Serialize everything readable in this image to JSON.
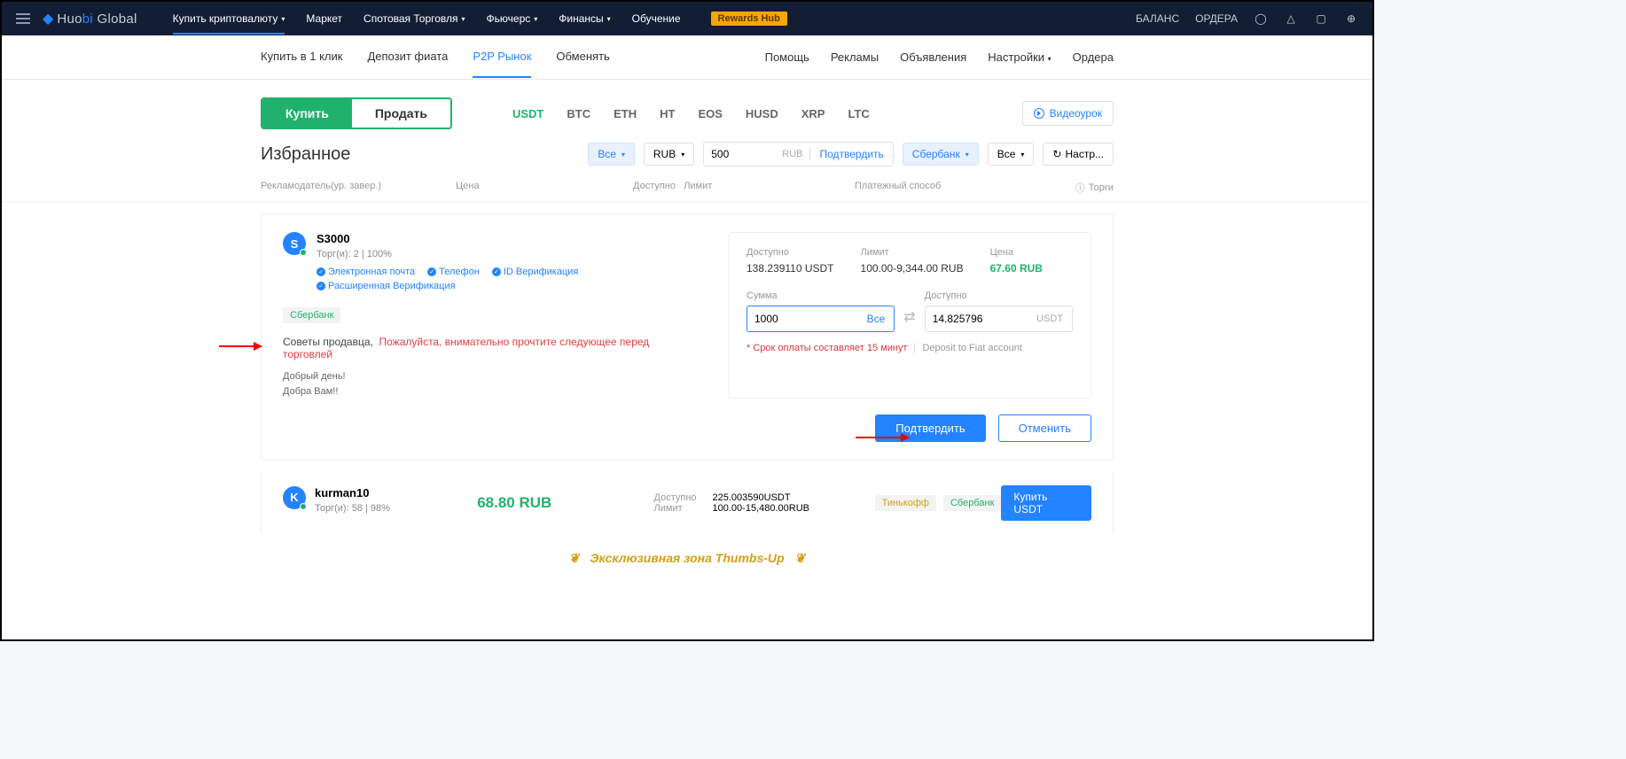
{
  "topnav": {
    "logo_prefix": "Huo",
    "logo_mid": "bi",
    "logo_suffix": " Global",
    "items": [
      "Купить криптовалюту",
      "Маркет",
      "Спотовая Торговля",
      "Фьючерс",
      "Финансы",
      "Обучение"
    ],
    "rewards": "Rewards Hub",
    "right": [
      "БАЛАНС",
      "ОРДЕРА"
    ]
  },
  "subnav": {
    "left": [
      "Купить в 1 клик",
      "Депозит фиата",
      "P2P Рынок",
      "Обменять"
    ],
    "right": [
      "Помощь",
      "Рекламы",
      "Объявления",
      "Настройки",
      "Ордера"
    ]
  },
  "buysell": {
    "buy": "Купить",
    "sell": "Продать"
  },
  "coins": [
    "USDT",
    "BTC",
    "ETH",
    "HT",
    "EOS",
    "HUSD",
    "XRP",
    "LTC"
  ],
  "video_link": "Видеоурок",
  "filters": {
    "title": "Избранное",
    "all": "Все",
    "fiat": "RUB",
    "amount": "500",
    "amount_cur": "RUB",
    "confirm": "Подтвердить",
    "bank": "Сбербанк",
    "all2": "Все",
    "settings": "Настр..."
  },
  "table_head": {
    "adv": "Рекламодатель(ур. завер.)",
    "price": "Цена",
    "avail": "Доступно",
    "limit": "Лимит",
    "pay": "Платежный способ",
    "trades": "Торги"
  },
  "card": {
    "avatar": "S",
    "name": "S3000",
    "stats": "Торг(и): 2 | 100%",
    "badges": [
      "Электронная почта",
      "Телефон",
      "ID Верификация",
      "Расширенная Верификация"
    ],
    "pay_method": "Сбербанк",
    "advice_lbl": "Советы продавца,",
    "advice_warn": "Пожалуйста, внимательно прочтите следующее перед торговлей",
    "greet1": "Добрый день!",
    "greet2": "Добра Вам!!",
    "box": {
      "avail_lbl": "Доступно",
      "avail_val": "138.239110 USDT",
      "limit_lbl": "Лимит",
      "limit_val": "100.00-9,344.00 RUB",
      "price_lbl": "Цена",
      "price_val": "67.60 RUB",
      "sum_lbl": "Сумма",
      "sum_val": "1000",
      "all": "Все",
      "recv_lbl": "Доступно",
      "recv_val": "14.825796",
      "recv_unit": "USDT",
      "deadline": "* Срок оплаты составляет 15 минут",
      "deposit": "Deposit to Fiat account"
    },
    "confirm": "Подтвердить",
    "cancel": "Отменить"
  },
  "listing2": {
    "avatar": "K",
    "name": "kurman10",
    "stats": "Торг(и): 58 | 98%",
    "price": "68.80 RUB",
    "avail_lbl": "Доступно",
    "avail_val": "225.003590USDT",
    "limit_lbl": "Лимит",
    "limit_val": "100.00-15,480.00RUB",
    "pay1": "Тинькофф",
    "pay2": "Сбербанк",
    "buy": "Купить USDT"
  },
  "banner": "Эксклюзивная зона Thumbs-Up"
}
